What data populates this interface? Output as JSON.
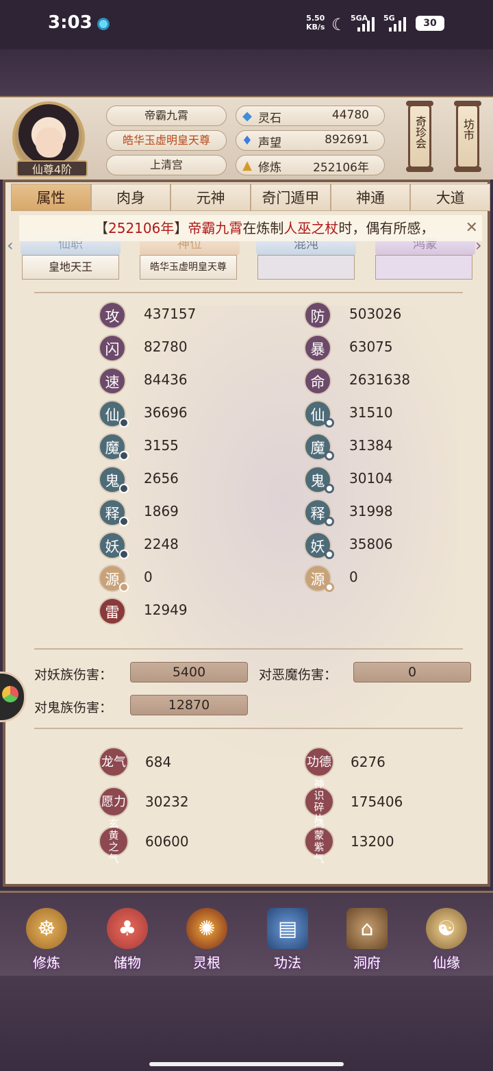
{
  "status_bar": {
    "time": "3:03",
    "net_speed": "5.50\nKB/s",
    "sig1": "5GA",
    "sig2": "5G",
    "battery": "30"
  },
  "player": {
    "name": "帝霸九霄",
    "title": "皓华玉虚明皇天尊",
    "sect": "上清宫",
    "rank": "仙尊4阶"
  },
  "resources": [
    {
      "icon": "spirit-stone-icon",
      "label": "灵石",
      "value": "44780"
    },
    {
      "icon": "reputation-icon",
      "label": "声望",
      "value": "892691"
    },
    {
      "icon": "cultivation-icon",
      "label": "修炼",
      "value": "252106年"
    }
  ],
  "side_buttons": {
    "treasure": "奇珍会",
    "market": "坊市"
  },
  "tabs": [
    "属性",
    "肉身",
    "元神",
    "奇门遁甲",
    "神通",
    "大道"
  ],
  "ticker": {
    "open": "【",
    "years": "252106年",
    "close": "】",
    "name": "帝霸九霄",
    "mid": "在炼制",
    "item": "人巫之杖",
    "end": "时，偶有所感，"
  },
  "subtabs": [
    {
      "label": "仙职",
      "value": "皇地天王"
    },
    {
      "label": "神位",
      "value": "皓华玉虚明皇天尊"
    },
    {
      "label": "混沌",
      "value": ""
    },
    {
      "label": "鸿蒙",
      "value": ""
    }
  ],
  "stats_left": [
    {
      "char": "攻",
      "value": "437157"
    },
    {
      "char": "闪",
      "value": "82780"
    },
    {
      "char": "速",
      "value": "84436"
    },
    {
      "char": "仙",
      "value": "36696"
    },
    {
      "char": "魔",
      "value": "3155"
    },
    {
      "char": "鬼",
      "value": "2656"
    },
    {
      "char": "释",
      "value": "1869"
    },
    {
      "char": "妖",
      "value": "2248"
    },
    {
      "char": "源",
      "value": "0"
    },
    {
      "char": "雷",
      "value": "12949"
    }
  ],
  "stats_right": [
    {
      "char": "防",
      "value": "503026"
    },
    {
      "char": "暴",
      "value": "63075"
    },
    {
      "char": "命",
      "value": "2631638"
    },
    {
      "char": "仙",
      "value": "31510"
    },
    {
      "char": "魔",
      "value": "31384"
    },
    {
      "char": "鬼",
      "value": "30104"
    },
    {
      "char": "释",
      "value": "31998"
    },
    {
      "char": "妖",
      "value": "35806"
    },
    {
      "char": "源",
      "value": "0"
    }
  ],
  "damage": [
    {
      "label": "对妖族伤害：",
      "value": "5400"
    },
    {
      "label": "对恶魔伤害：",
      "value": "0"
    },
    {
      "label": "对鬼族伤害：",
      "value": "12870"
    }
  ],
  "extras": [
    {
      "label": "龙气",
      "value": "684"
    },
    {
      "label": "功德",
      "value": "6276"
    },
    {
      "label": "愿力",
      "value": "30232"
    },
    {
      "label": "神识碎片",
      "value": "175406"
    },
    {
      "label": "玄黄之气",
      "value": "60600"
    },
    {
      "label": "鸿蒙紫气",
      "value": "13200"
    }
  ],
  "nav": [
    "修炼",
    "储物",
    "灵根",
    "功法",
    "洞府",
    "仙缘"
  ]
}
